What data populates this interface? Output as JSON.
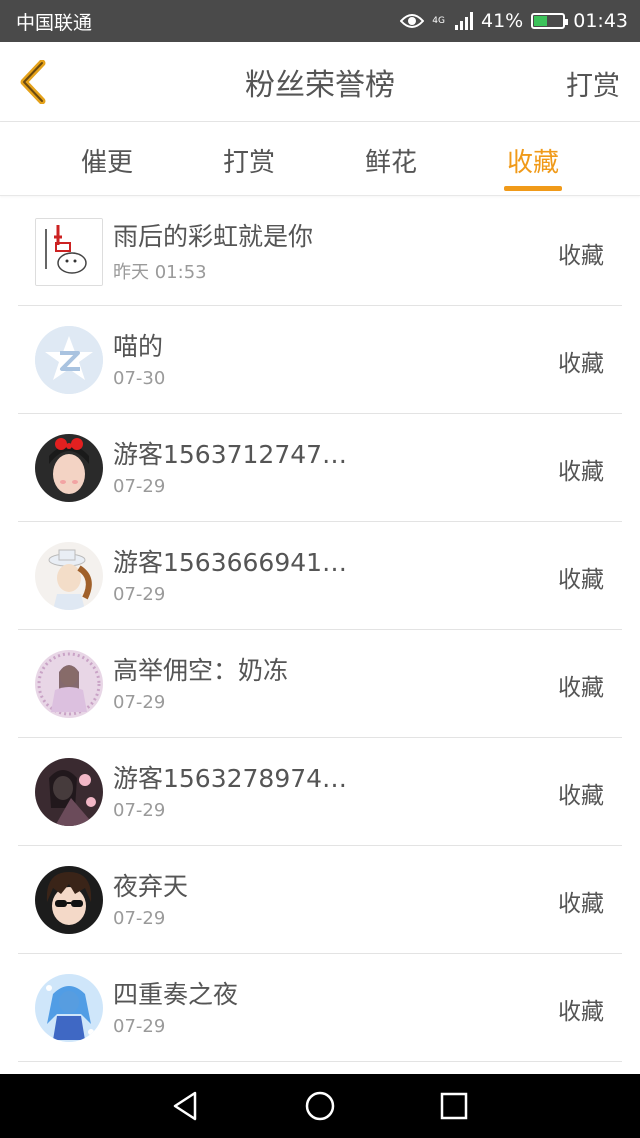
{
  "status_bar": {
    "carrier": "中国联通",
    "network": "4G",
    "battery": "41%",
    "time": "01:43"
  },
  "header": {
    "title": "粉丝荣誉榜",
    "action": "打赏"
  },
  "tabs": [
    {
      "label": "催更",
      "active": false
    },
    {
      "label": "打赏",
      "active": false
    },
    {
      "label": "鲜花",
      "active": false
    },
    {
      "label": "收藏",
      "active": true
    }
  ],
  "rows": [
    {
      "name": "雨后的彩虹就是你",
      "time": "昨天 01:53",
      "action": "收藏"
    },
    {
      "name": "喵的",
      "time": "07-30",
      "action": "收藏"
    },
    {
      "name": "游客1563712747…",
      "time": "07-29",
      "action": "收藏"
    },
    {
      "name": "游客1563666941…",
      "time": "07-29",
      "action": "收藏"
    },
    {
      "name": "高举佣空：奶冻",
      "time": "07-29",
      "action": "收藏"
    },
    {
      "name": "游客1563278974…",
      "time": "07-29",
      "action": "收藏"
    },
    {
      "name": "夜弃天",
      "time": "07-29",
      "action": "收藏"
    },
    {
      "name": "四重奏之夜",
      "time": "07-29",
      "action": "收藏"
    }
  ],
  "colors": {
    "accent": "#f09a19",
    "status_bar": "#4a4a4a",
    "nav_bar": "#000000"
  },
  "icons": {
    "back": "chevron-left-icon",
    "eye": "eye-icon",
    "signal": "signal-icon",
    "battery": "battery-icon",
    "nav_back": "triangle-back-icon",
    "nav_home": "circle-home-icon",
    "nav_recent": "square-recent-icon"
  }
}
